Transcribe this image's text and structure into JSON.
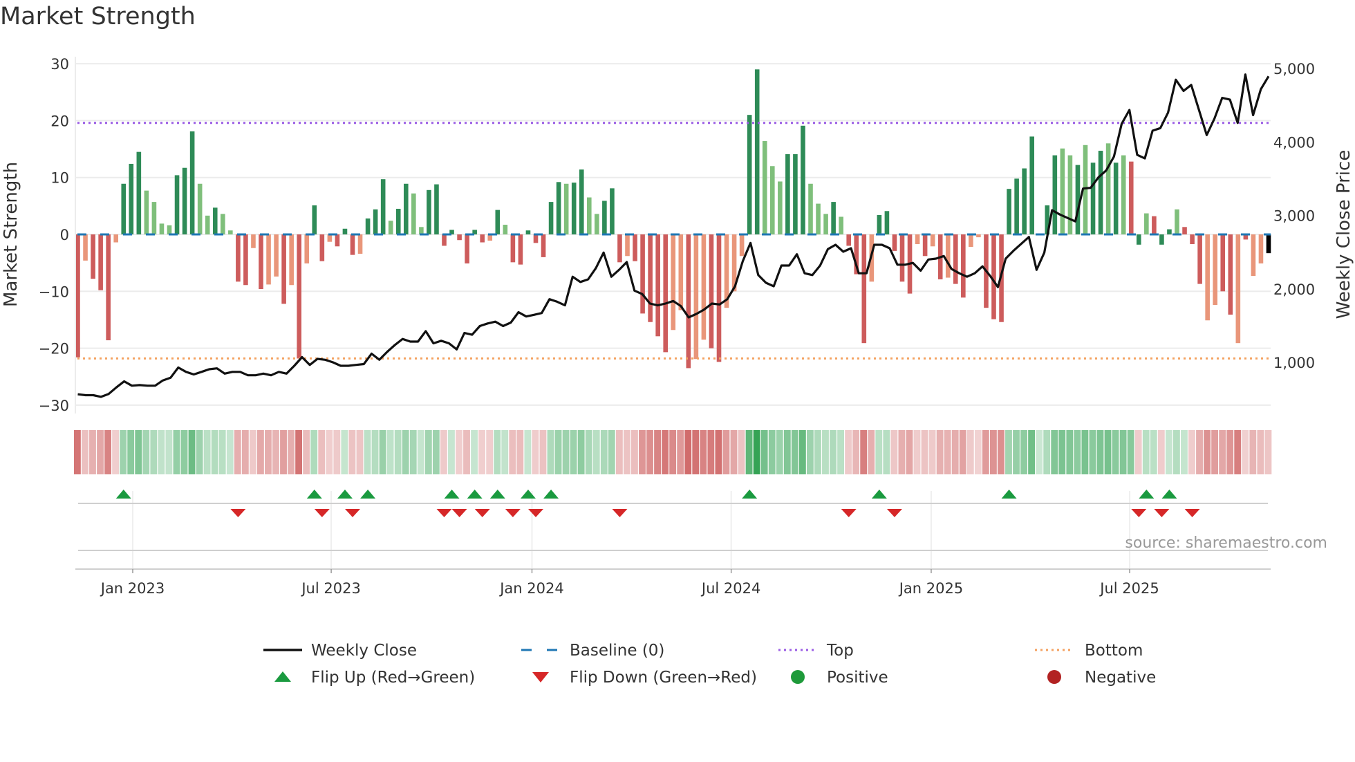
{
  "title": "Market Strength",
  "source": "source: sharemaestro.com",
  "colors": {
    "strong_pos": "#2e8b57",
    "weak_pos": "#7fbf7b",
    "strong_neg": "#cd5c5c",
    "weak_neg": "#e9967a",
    "close": "#111111",
    "baseline": "#1f77b4",
    "top": "#9b5de5",
    "bottom": "#f4a261",
    "flip_up": "#1a9a3f",
    "flip_down": "#d62728",
    "positive": "#1e9a3a",
    "negative": "#b22222"
  },
  "chart_data": {
    "type": "bar",
    "title": "Market Strength",
    "ylabel": "Market Strength",
    "y2label": "Weekly Close Price",
    "ylim": [
      -30,
      30
    ],
    "y_ticks": [
      "30",
      "20",
      "10",
      "0",
      "−10",
      "−20",
      "−30"
    ],
    "y_tick_values": [
      30,
      20,
      10,
      0,
      -10,
      -20,
      -30
    ],
    "y2_ticks": [
      "5,000",
      "4,000",
      "3,000",
      "2,000",
      "1,000"
    ],
    "y2_tick_values": [
      5000,
      4000,
      3000,
      2000,
      1000
    ],
    "x_ticks": [
      "Jan 2023",
      "Jul 2023",
      "Jan 2024",
      "Jul 2024",
      "Jan 2025",
      "Jul 2025"
    ],
    "x_tick_weeks": [
      7.2,
      33.2,
      59.5,
      85.6,
      111.8,
      137.8
    ],
    "top_level": 19.6,
    "bottom_level": -21.8,
    "strength": [
      -21.6,
      -4.6,
      -7.8,
      -9.8,
      -18.6,
      -1.4,
      8.9,
      12.4,
      14.5,
      7.7,
      5.7,
      1.9,
      1.6,
      10.4,
      11.7,
      18.1,
      8.9,
      3.3,
      4.7,
      3.6,
      0.7,
      -8.3,
      -8.9,
      -2.4,
      -9.6,
      -8.8,
      -7.4,
      -12.2,
      -8.9,
      -21.8,
      -5.1,
      5.1,
      -4.7,
      -1.3,
      -2.1,
      1.0,
      -3.6,
      -3.4,
      2.8,
      4.4,
      9.7,
      2.4,
      4.5,
      8.9,
      7.2,
      1.3,
      7.8,
      8.8,
      -2.0,
      0.8,
      -1.0,
      -5.1,
      0.8,
      -1.4,
      -1.1,
      4.3,
      1.7,
      -4.9,
      -5.3,
      0.7,
      -1.5,
      -4.0,
      5.7,
      9.2,
      8.9,
      9.1,
      11.4,
      6.5,
      3.6,
      5.9,
      8.1,
      -4.9,
      -3.8,
      -4.7,
      -13.9,
      -15.4,
      -17.9,
      -20.7,
      -16.8,
      -13.3,
      -23.5,
      -21.9,
      -18.5,
      -20.0,
      -22.4,
      -12.9,
      -10.0,
      -3.8,
      21.0,
      29.0,
      16.4,
      12.0,
      9.3,
      14.1,
      14.1,
      19.1,
      8.9,
      5.4,
      3.6,
      5.7,
      3.1,
      -2.0,
      -7.0,
      -19.1,
      -8.3,
      3.4,
      4.1,
      -2.9,
      -8.3,
      -10.4,
      -1.7,
      -3.8,
      -2.1,
      -7.9,
      -7.6,
      -8.7,
      -11.1,
      -2.2,
      -0.5,
      -12.9,
      -14.9,
      -15.4,
      8.0,
      9.8,
      11.6,
      17.2,
      0,
      5.1,
      13.9,
      15.1,
      13.9,
      12.2,
      15.7,
      12.6,
      14.7,
      16.0,
      12.6,
      13.9,
      12.8,
      -1.8,
      3.7,
      3.2,
      -1.8,
      0.9,
      4.4,
      1.3,
      -1.7,
      -8.7,
      -15.1,
      -12.4,
      -10.0,
      -14.1,
      -19.1,
      -0.9,
      -7.3,
      -5.1,
      -3.3
    ],
    "shade": "RrRRRrGGGggggGGGggGggRRrRrrRrRrGRrRGRrGGGgGGggGGRGRRGRrGgRRGRRGGgGGggGGRrRRRRRrrRrrRRrrrGGgggGGGgggGgRRRrGGRRRrRrRrRRrrRRRGGGGGGGggGgGGgGgRGgRGGgRRRrrRRrRrr",
    "close": [
      565,
      553,
      553,
      530,
      570,
      659,
      741,
      682,
      690,
      682,
      682,
      753,
      790,
      929,
      870,
      835,
      870,
      906,
      918,
      847,
      870,
      870,
      824,
      824,
      847,
      824,
      870,
      847,
      953,
      1071,
      965,
      1047,
      1035,
      1000,
      953,
      953,
      965,
      976,
      1118,
      1035,
      1141,
      1235,
      1318,
      1282,
      1282,
      1424,
      1259,
      1294,
      1259,
      1176,
      1400,
      1376,
      1494,
      1529,
      1553,
      1494,
      1541,
      1682,
      1624,
      1647,
      1671,
      1859,
      1824,
      1776,
      2165,
      2094,
      2129,
      2282,
      2494,
      2165,
      2259,
      2365,
      1976,
      1929,
      1800,
      1776,
      1800,
      1835,
      1765,
      1612,
      1659,
      1718,
      1800,
      1788,
      1859,
      2035,
      2376,
      2624,
      2188,
      2082,
      2035,
      2318,
      2318,
      2471,
      2212,
      2188,
      2318,
      2541,
      2600,
      2506,
      2553,
      2212,
      2212,
      2600,
      2600,
      2553,
      2329,
      2329,
      2353,
      2247,
      2400,
      2412,
      2447,
      2271,
      2212,
      2165,
      2212,
      2306,
      2176,
      2024,
      2412,
      2518,
      2612,
      2706,
      2259,
      2494,
      3071,
      3012,
      2965,
      2918,
      3365,
      3376,
      3518,
      3612,
      3800,
      4247,
      4435,
      3824,
      3776,
      4153,
      4188,
      4400,
      4847,
      4694,
      4776,
      4435,
      4094,
      4318,
      4600,
      4576,
      4259,
      4918,
      4365,
      4718,
      4894
    ],
    "flip_up_weeks": [
      6,
      31,
      35,
      38,
      49,
      52,
      55,
      59,
      62,
      88,
      105,
      122,
      140,
      143
    ],
    "flip_down_weeks": [
      21,
      32,
      36,
      48,
      50,
      53,
      57,
      60,
      71,
      101,
      107,
      139,
      142,
      146
    ]
  },
  "legend": [
    {
      "label": "Weekly Close",
      "kind": "line"
    },
    {
      "label": "Baseline (0)",
      "kind": "dash"
    },
    {
      "label": "Top",
      "kind": "dotpurple"
    },
    {
      "label": "Bottom",
      "kind": "dotorange"
    },
    {
      "label": "Flip Up (Red→Green)",
      "kind": "up"
    },
    {
      "label": "Flip Down (Green→Red)",
      "kind": "down"
    },
    {
      "label": "Positive",
      "kind": "pos"
    },
    {
      "label": "Negative",
      "kind": "neg"
    }
  ]
}
